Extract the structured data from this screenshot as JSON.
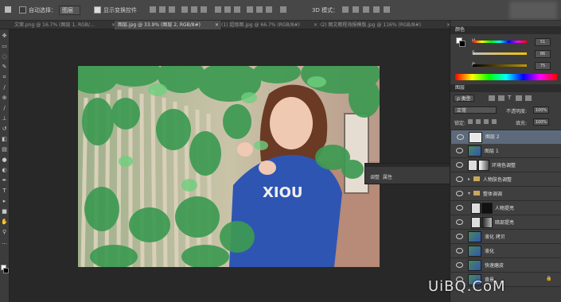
{
  "options_bar": {
    "auto_select_label": "自动选择：",
    "auto_select_target": "图层",
    "show_transform_label": "显示变换控件",
    "mode_3d_label": "3D 模式："
  },
  "tabs": [
    {
      "label": "文案.png @ 16.7% (图层 1, RGB/..."
    },
    {
      "label": "图层.jpg @ 33.9% (图层 2, RGB/8#)"
    },
    {
      "label": "(1) 超级图.jpg @ 66.7% (RGB/8#)"
    },
    {
      "label": "(2) 图文教程海报模版.jpg @ 116% (RGB/8#)"
    }
  ],
  "color_panel": {
    "title": "颜色",
    "channels": [
      {
        "label": "H",
        "value": "51"
      },
      {
        "label": "S",
        "value": "86"
      },
      {
        "label": "B",
        "value": "75"
      }
    ]
  },
  "layers_panel": {
    "title": "图层",
    "kind_filter": "类型",
    "blend_mode": "正常",
    "opacity_label": "不透明度:",
    "opacity_value": "100%",
    "lock_label": "锁定:",
    "fill_label": "填充:",
    "fill_value": "100%",
    "layers": [
      {
        "name": "图层 2",
        "selected": true
      },
      {
        "name": "图层 1",
        "selected": false
      },
      {
        "name": "环境色调整",
        "selected": false
      },
      {
        "name": "人物肤色调整",
        "selected": false
      },
      {
        "name": "整体调调",
        "selected": false
      },
      {
        "name": "人物提亮",
        "selected": false
      },
      {
        "name": "暗部提亮",
        "selected": false
      },
      {
        "name": "液化 拷贝",
        "selected": false
      },
      {
        "name": "液化",
        "selected": false
      },
      {
        "name": "快速磨皮",
        "selected": false
      },
      {
        "name": "背景",
        "selected": false
      }
    ]
  },
  "properties_panel": {
    "title": "属性",
    "tab": "调整",
    "tab_label": "属性"
  },
  "photo": {
    "shirt_text": "XIOU"
  },
  "colors": {
    "foreground": "#ffffff",
    "background": "#000000",
    "accent_selected_row": "#5d6a7b"
  },
  "watermark": "UiBQ.CoM"
}
